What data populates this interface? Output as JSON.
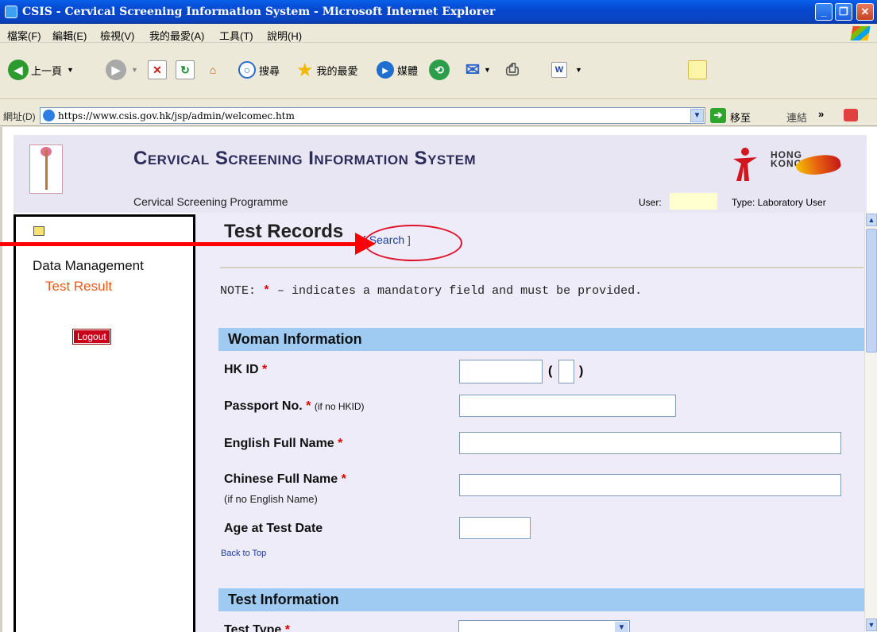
{
  "window": {
    "title": "CSIS - Cervical Screening Information System - Microsoft Internet Explorer"
  },
  "menu": [
    "檔案(F)",
    "編輯(E)",
    "檢視(V)",
    "我的最愛(A)",
    "工具(T)",
    "說明(H)"
  ],
  "toolbar": {
    "back": "上一頁",
    "search": "搜尋",
    "favorites": "我的最愛",
    "media": "媒體"
  },
  "address": {
    "label": "網址(D)",
    "url": "https://www.csis.gov.hk/jsp/admin/welcomec.htm",
    "go": "移至",
    "links": "連結"
  },
  "header": {
    "title_first": "C",
    "title_word1": "ervical ",
    "title_s": "S",
    "title_word2": "creening ",
    "title_i": "I",
    "title_word3": "nformation ",
    "title_s2": "S",
    "title_word4": "ystem",
    "programme": "Cervical Screening Programme",
    "user_label": "User:",
    "type_label": "Type: Laboratory User",
    "hk_line1": "HONG",
    "hk_line2": "KONG"
  },
  "sidebar": {
    "data_management": "Data Management",
    "test_result": "Test Result",
    "logout": "Logout"
  },
  "main": {
    "page_title": "Test Records",
    "search_open": "[ ",
    "search_link": "Search",
    "search_close": " ]",
    "note_prefix": "NOTE: ",
    "note_star": "*",
    "note_text": " – indicates a mandatory field and must be provided.",
    "section_woman": "Woman Information",
    "hkid_label": "HK ID",
    "passport_label": "Passport No.",
    "passport_hint": "(if no HKID)",
    "english_name_label": "English Full Name",
    "chinese_name_label": "Chinese Full Name",
    "chinese_name_hint": "(if no English Name)",
    "age_label": "Age at Test Date",
    "back_to_top": "Back to Top",
    "section_test": "Test Information",
    "test_type_label": "Test Type",
    "required_star": "*",
    "paren_open": "(",
    "paren_close": ")"
  }
}
